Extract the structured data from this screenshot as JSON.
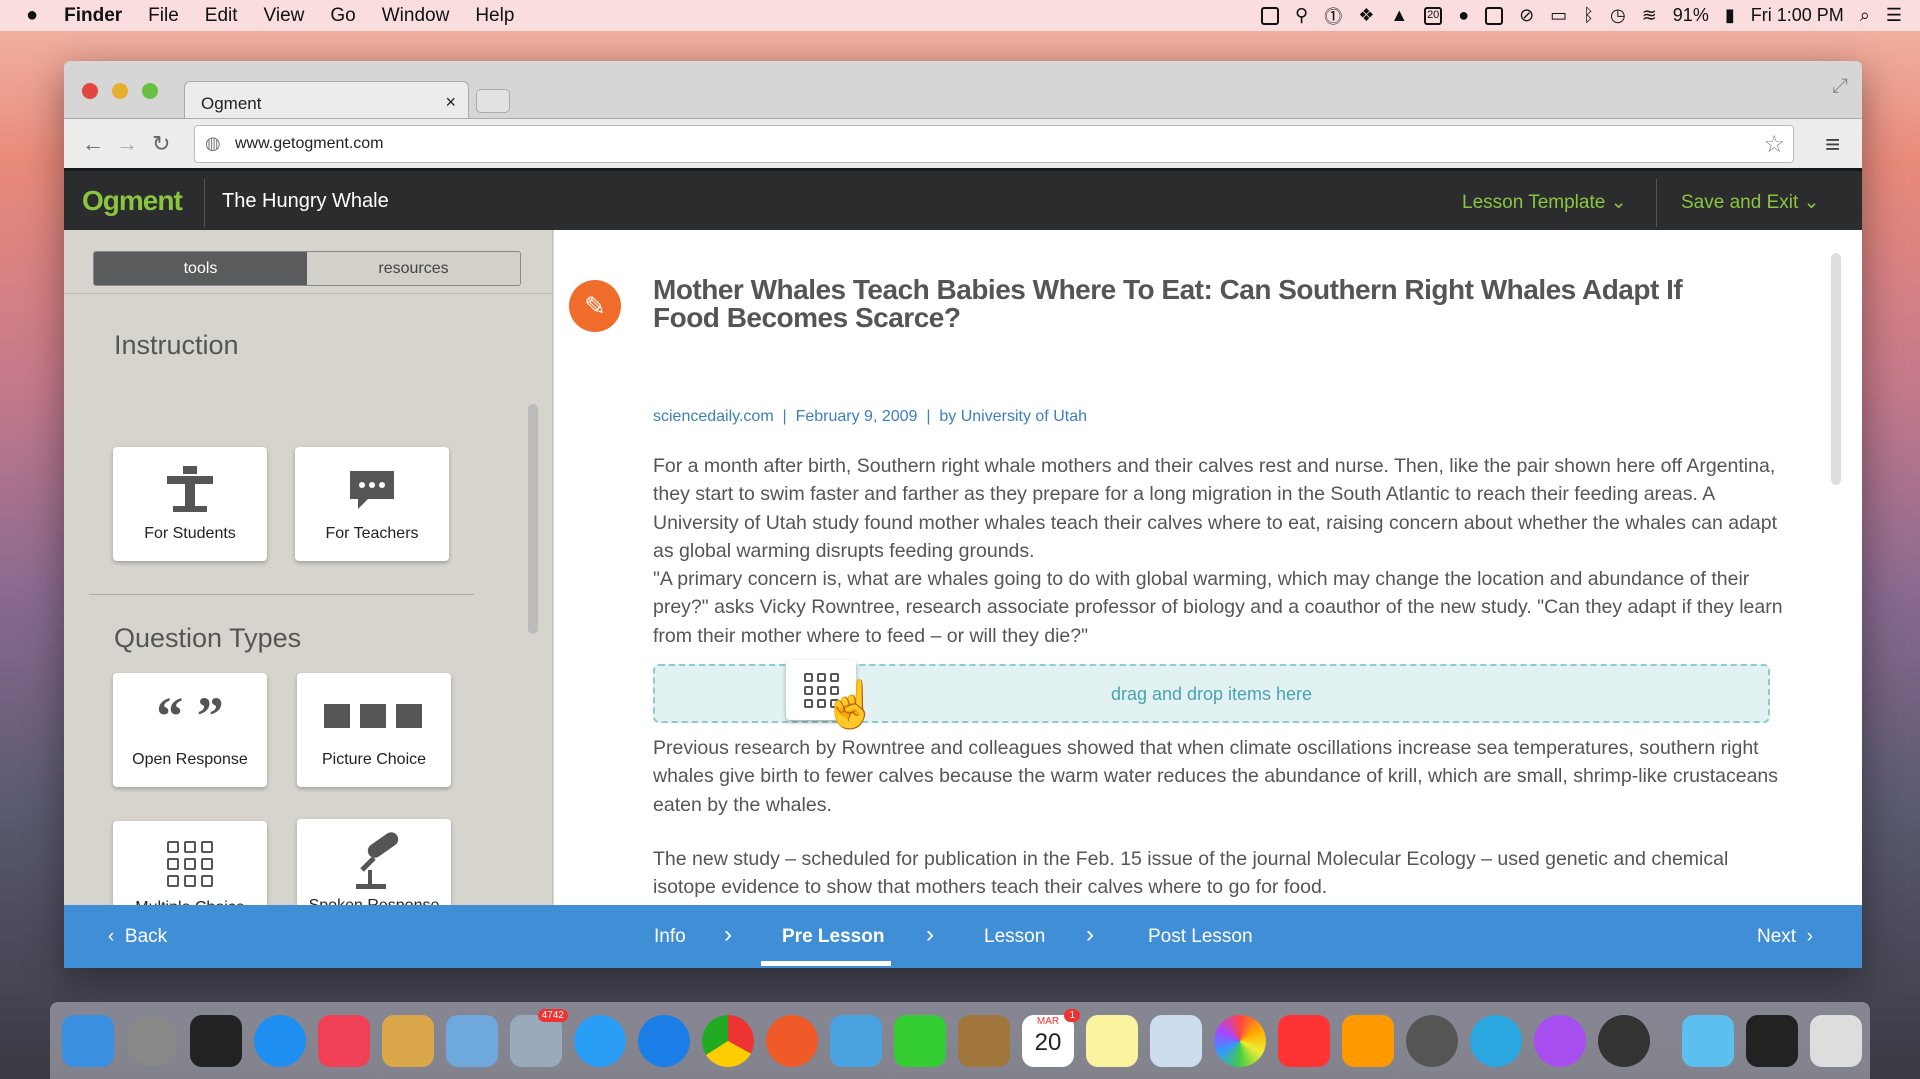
{
  "menubar": {
    "apple": "",
    "items": [
      "Finder",
      "File",
      "Edit",
      "View",
      "Go",
      "Window",
      "Help"
    ],
    "battery": "91%",
    "clock": "Fri 1:00 PM",
    "calendar_day": "20"
  },
  "browser": {
    "tab_title": "Ogment",
    "tab_close": "×",
    "url": "www.getogment.com"
  },
  "app": {
    "logo": "Ogment",
    "doc_title": "The Hungry Whale",
    "lesson_template": "Lesson Template",
    "save_exit": "Save and Exit",
    "accent": "#8bc53f"
  },
  "sidebar": {
    "tabs": [
      "tools",
      "resources"
    ],
    "instruction": {
      "heading": "Instruction",
      "items": [
        "For Students",
        "For Teachers"
      ]
    },
    "questions": {
      "heading": "Question Types",
      "items": [
        "Open Response",
        "Picture Choice",
        "Multiple Choice",
        "Spoken Response"
      ]
    }
  },
  "article": {
    "title": "Mother Whales Teach Babies Where To Eat: Can Southern Right Whales Adapt If Food Becomes Scarce?",
    "source": "sciencedaily.com",
    "date": "February 9, 2009",
    "author": "by University of Utah",
    "sep": "|",
    "p1": "For a month after birth, Southern right whale mothers and their calves rest and nurse. Then, like the pair shown here off Argentina, they start to swim faster and farther as they prepare for a long migration in the South Atlantic to reach their feeding areas. A University of Utah study found mother whales teach their calves where to eat, raising concern about whether the whales can adapt as global warming disrupts feeding grounds.",
    "p1b": "\"A primary concern is, what are whales going to do with global warming, which may change the location and abundance of their prey?\" asks Vicky Rowntree, research associate professor of biology and a coauthor of the new study. \"Can they adapt if they learn from their mother where to feed – or will they die?\"",
    "dropzone": "drag and drop items here",
    "p2": "Previous research by Rowntree and colleagues showed that when climate oscillations increase sea temperatures, southern right whales give birth to fewer calves because the warm water reduces the abundance of krill, which are small, shrimp-like crustaceans eaten by the whales.",
    "p3": "The new study – scheduled for publication in the Feb. 15 issue of the journal Molecular Ecology – used genetic and chemical isotope evidence to show that mothers teach their calves where to go for food."
  },
  "footer": {
    "back": "Back",
    "steps": [
      "Info",
      "Pre Lesson",
      "Lesson",
      "Post Lesson"
    ],
    "active_step": "Pre Lesson",
    "next": "Next",
    "color": "#3f8ed6"
  },
  "dock": {
    "mail_badge": "4742",
    "calendar_month": "MAR",
    "calendar_day": "20",
    "calendar_badge": "1"
  }
}
